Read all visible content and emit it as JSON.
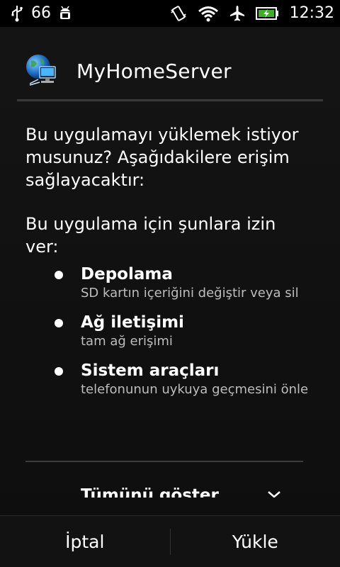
{
  "status_bar": {
    "notification_count": "66",
    "time": "12:32",
    "icons": [
      "usb-icon",
      "android-debug-icon",
      "vibrate-icon",
      "wifi-icon",
      "airplane-icon",
      "battery-charging-icon"
    ]
  },
  "header": {
    "app_name": "MyHomeServer",
    "app_icon": "globe-computer-icon"
  },
  "content": {
    "intro": "Bu uygulamayı yüklemek istiyor musunuz? Aşağıdakilere erişim sağlayacaktır:",
    "grant_text": "Bu uygulama için şunlara izin ver:",
    "permissions": [
      {
        "title": "Depolama",
        "description": "SD kartın içeriğini değiştir veya sil"
      },
      {
        "title": "Ağ iletişimi",
        "description": "tam ağ erişimi"
      },
      {
        "title": "Sistem araçları",
        "description": "telefonunun uykuya geçmesini önle"
      }
    ],
    "show_all_label": "Tümünü göster"
  },
  "buttons": {
    "cancel_label": "İptal",
    "install_label": "Yükle"
  },
  "colors": {
    "background": "#141414",
    "text": "#ffffff",
    "secondary_text": "#bdbdbd",
    "divider": "#3a3a3a"
  }
}
